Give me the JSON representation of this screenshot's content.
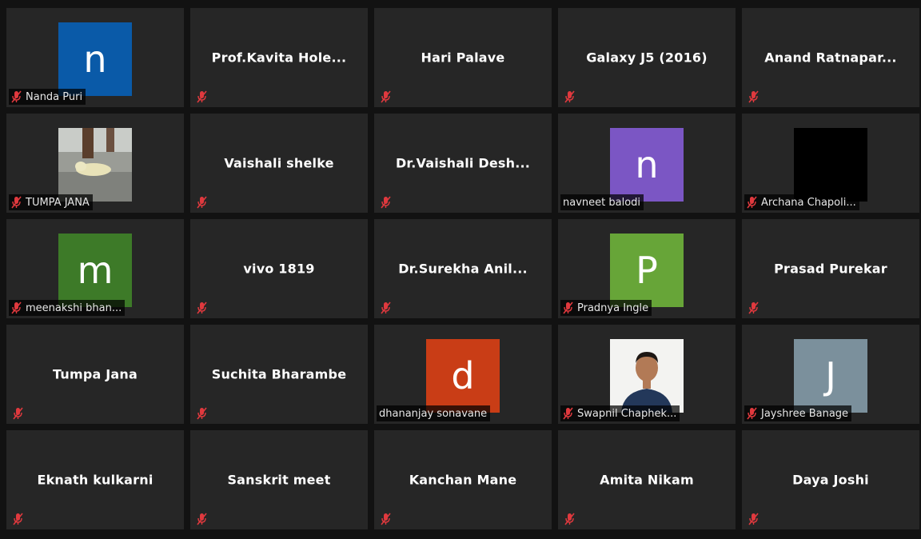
{
  "colors": {
    "tile_bg": "#262626",
    "page_bg": "#121212",
    "muted_icon": "#e0393e"
  },
  "participants": [
    {
      "name": "Nanda Puri",
      "avatar_letter": "n",
      "avatar_color": "#0a5aa8",
      "muted": true
    },
    {
      "name": "Prof.Kavita  Hole...",
      "muted": true
    },
    {
      "name": "Hari Palave",
      "muted": true
    },
    {
      "name": "Galaxy J5 (2016)",
      "muted": true
    },
    {
      "name": "Anand  Ratnapar...",
      "muted": true
    },
    {
      "name": "TUMPA JANA",
      "avatar_photo": "bird-photo",
      "muted": true
    },
    {
      "name": "Vaishali shelke",
      "muted": true
    },
    {
      "name": "Dr.Vaishali  Desh...",
      "muted": true
    },
    {
      "name": "navneet balodi",
      "avatar_letter": "n",
      "avatar_color": "#7b56c4",
      "muted": false
    },
    {
      "name": "Archana Chapoli...",
      "avatar_color": "#000000",
      "muted": true
    },
    {
      "name": "meenakshi bhan...",
      "avatar_letter": "m",
      "avatar_color": "#3d7a28",
      "muted": true
    },
    {
      "name": "vivo 1819",
      "muted": true
    },
    {
      "name": "Dr.Surekha  Anil...",
      "muted": true
    },
    {
      "name": "Pradnya Ingle",
      "avatar_letter": "P",
      "avatar_color": "#67a538",
      "muted": true
    },
    {
      "name": "Prasad Purekar",
      "muted": true
    },
    {
      "name": "Tumpa Jana",
      "muted": true
    },
    {
      "name": "Suchita Bharambe",
      "muted": true
    },
    {
      "name": "dhananjay sonavane",
      "avatar_letter": "d",
      "avatar_color": "#c93d16",
      "muted": false
    },
    {
      "name": "Swapnil Chaphek...",
      "avatar_photo": "person-photo",
      "muted": true
    },
    {
      "name": "Jayshree Banage",
      "avatar_letter": "J",
      "avatar_color": "#7b909c",
      "muted": true
    },
    {
      "name": "Eknath kulkarni",
      "muted": true
    },
    {
      "name": "Sanskrit meet",
      "muted": true
    },
    {
      "name": "Kanchan Mane",
      "muted": true
    },
    {
      "name": "Amita Nikam",
      "muted": true
    },
    {
      "name": "Daya Joshi",
      "muted": true
    }
  ]
}
